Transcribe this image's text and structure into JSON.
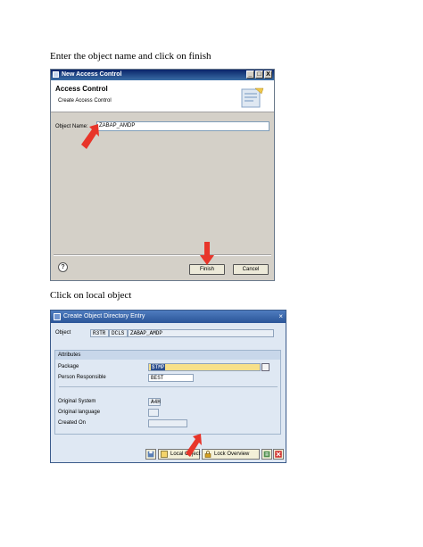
{
  "doc": {
    "instruction1": "Enter the object name and click on finish",
    "instruction2": "Click on local object"
  },
  "dialog1": {
    "window_title": "New Access Control",
    "window_buttons": [
      "_",
      "□",
      "X"
    ],
    "header_title": "Access Control",
    "header_subtitle": "Create Access Control",
    "object_name_label": "Object Name:",
    "object_name_value": "ZABAP_AMDP",
    "help_icon": "?",
    "finish_label": "Finish",
    "cancel_label": "Cancel"
  },
  "dialog2": {
    "window_title": "Create Object Directory Entry",
    "close_icon": "×",
    "object_label": "Object",
    "object_parts": [
      "R3TR",
      "DCLS",
      "ZABAP_AMDP"
    ],
    "attributes_header": "Attributes",
    "package_label": "Package",
    "package_value": "$TMP",
    "person_label": "Person Responsible",
    "person_value": "BEST",
    "orig_system_label": "Original System",
    "orig_system_value": "A4H",
    "orig_lang_label": "Original language",
    "orig_lang_value": "",
    "created_on_label": "Created On",
    "created_on_value": "",
    "local_object_label": "Local Object",
    "lock_overview_label": "Lock Overview"
  },
  "colors": {
    "pointer_arrow": "#e8352a",
    "sap_title_bar": "#2a5598",
    "eclipse_title_bar": "#0a246a"
  }
}
